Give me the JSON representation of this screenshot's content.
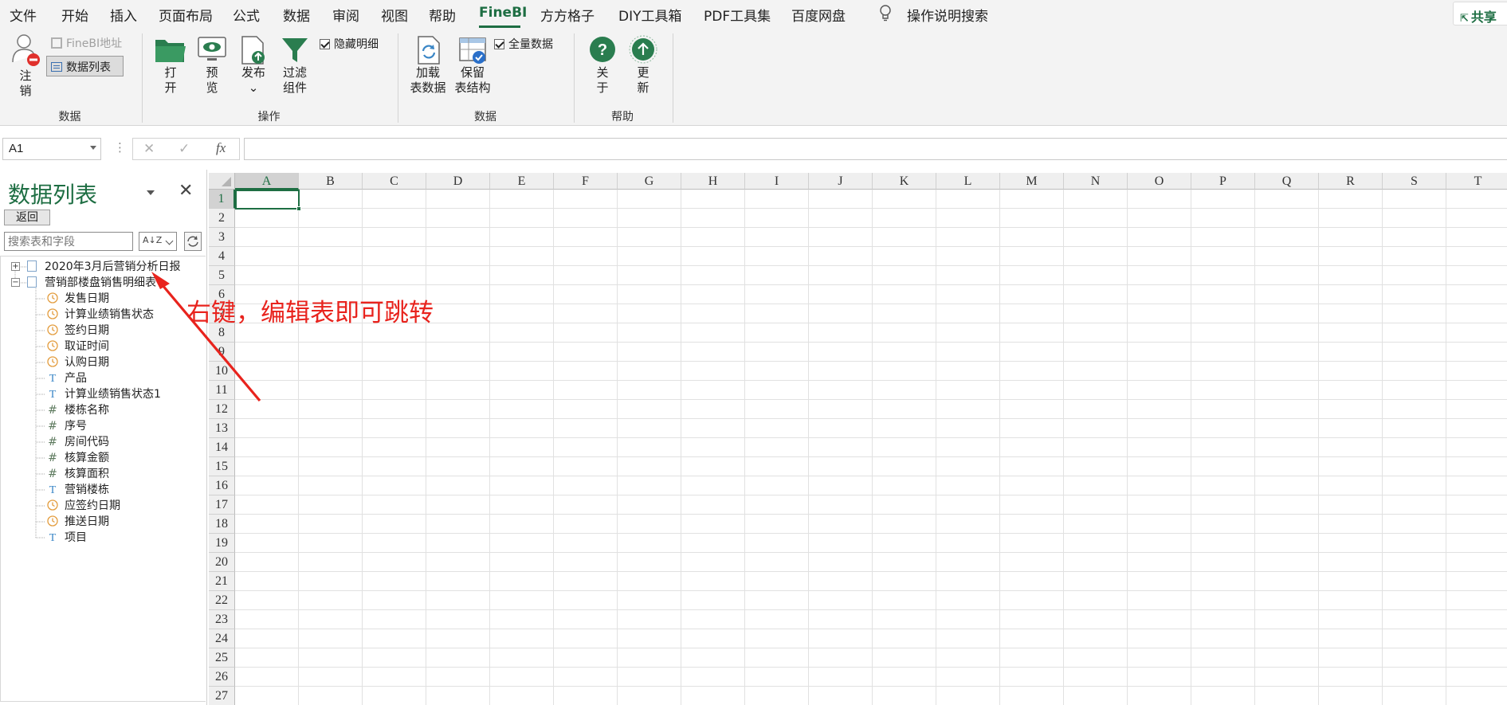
{
  "menu": {
    "items": [
      "文件",
      "开始",
      "插入",
      "页面布局",
      "公式",
      "数据",
      "审阅",
      "视图",
      "帮助",
      "FineBI",
      "方方格子",
      "DIY工具箱",
      "PDF工具集",
      "百度网盘"
    ],
    "active": "FineBI",
    "tell_me": "操作说明搜索",
    "share": "共享"
  },
  "ribbon": {
    "logout": [
      "注",
      "销"
    ],
    "finebi_address": "FineBI地址",
    "data_list": "数据列表",
    "group_data1": "数据",
    "open": [
      "打",
      "开"
    ],
    "preview": [
      "预",
      "览"
    ],
    "publish": [
      "发布",
      "⌄"
    ],
    "filter": [
      "过滤",
      "组件"
    ],
    "hide_detail": "隐藏明细",
    "group_ops": "操作",
    "load_data": [
      "加载",
      "表数据"
    ],
    "keep_structure": [
      "保留",
      "表结构"
    ],
    "full_data": "全量数据",
    "group_data2": "数据",
    "about": [
      "关",
      "于"
    ],
    "update": [
      "更",
      "新"
    ],
    "group_help": "帮助"
  },
  "formula_bar": {
    "name_box": "A1",
    "dots": "⋮",
    "cancel": "✕",
    "enter": "✓",
    "fx": "fx"
  },
  "panel": {
    "title": "数据列表",
    "close": "✕",
    "back": "返回",
    "search_placeholder": "搜索表和字段",
    "sort_label": "A↓Z",
    "tables": [
      {
        "name": "2020年3月后营销分析日报",
        "expander": "+"
      },
      {
        "name": "营销部楼盘销售明细表",
        "expander": "−"
      }
    ],
    "fields": [
      {
        "type": "date",
        "icon": "clock-icon",
        "name": "发售日期"
      },
      {
        "type": "date",
        "icon": "clock-icon",
        "name": "计算业绩销售状态"
      },
      {
        "type": "date",
        "icon": "clock-icon",
        "name": "签约日期"
      },
      {
        "type": "date",
        "icon": "clock-icon",
        "name": "取证时间"
      },
      {
        "type": "date",
        "icon": "clock-icon",
        "name": "认购日期"
      },
      {
        "type": "text",
        "icon": "text-type-icon",
        "name": "产品"
      },
      {
        "type": "text",
        "icon": "text-type-icon",
        "name": "计算业绩销售状态1"
      },
      {
        "type": "number",
        "icon": "number-type-icon",
        "name": "楼栋名称"
      },
      {
        "type": "number",
        "icon": "number-type-icon",
        "name": "序号"
      },
      {
        "type": "number",
        "icon": "number-type-icon",
        "name": "房间代码"
      },
      {
        "type": "number",
        "icon": "number-type-icon",
        "name": "核算金额"
      },
      {
        "type": "number",
        "icon": "number-type-icon",
        "name": "核算面积"
      },
      {
        "type": "text",
        "icon": "text-type-icon",
        "name": "营销楼栋"
      },
      {
        "type": "date",
        "icon": "clock-icon",
        "name": "应签约日期"
      },
      {
        "type": "date",
        "icon": "clock-icon",
        "name": "推送日期"
      },
      {
        "type": "text",
        "icon": "text-type-icon",
        "name": "项目"
      }
    ]
  },
  "sheet": {
    "columns": [
      "A",
      "B",
      "C",
      "D",
      "E",
      "F",
      "G",
      "H",
      "I",
      "J",
      "K",
      "L",
      "M",
      "N",
      "O",
      "P",
      "Q",
      "R",
      "S",
      "T"
    ],
    "rows": [
      "1",
      "2",
      "3",
      "4",
      "5",
      "6",
      "7",
      "8",
      "9",
      "10",
      "11",
      "12",
      "13",
      "14",
      "15",
      "16",
      "17",
      "18",
      "19",
      "20",
      "21",
      "22",
      "23",
      "24",
      "25",
      "26",
      "27"
    ],
    "selected_cell": "A1"
  },
  "annotation": {
    "text": "右键，编辑表即可跳转"
  },
  "colors": {
    "accent": "#1e6e43",
    "annotation": "#e8231d",
    "date_icon": "#e39c3d",
    "text_icon": "#3a86c6"
  }
}
